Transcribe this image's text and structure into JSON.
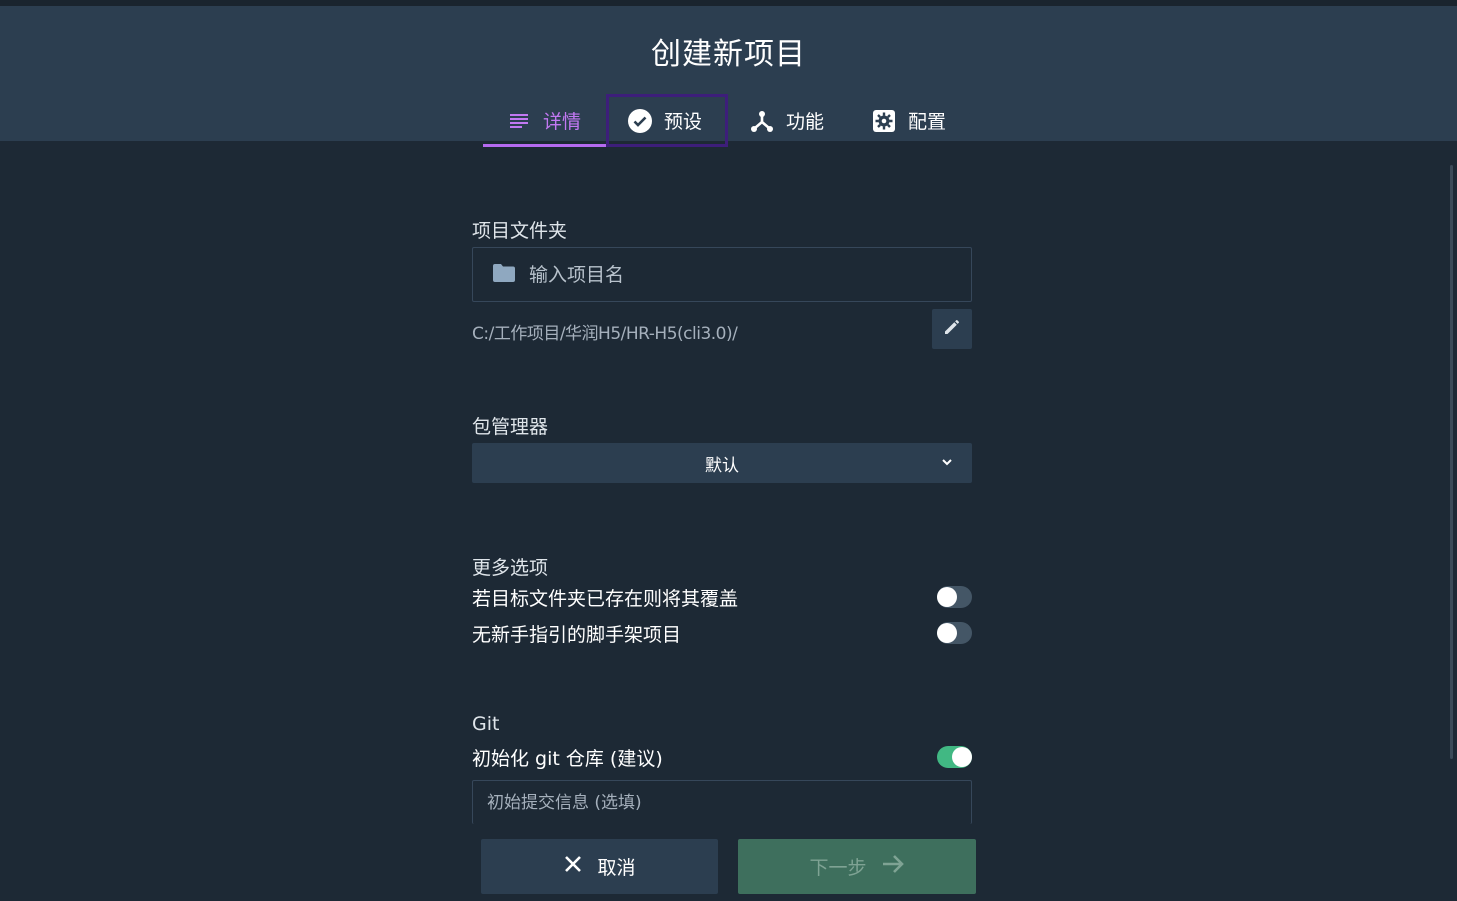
{
  "header": {
    "title": "创建新项目",
    "tabs": [
      {
        "label": "详情",
        "icon": "list-icon",
        "active": true
      },
      {
        "label": "预设",
        "icon": "check-circle-icon",
        "active": false
      },
      {
        "label": "功能",
        "icon": "branch-icon",
        "active": false
      },
      {
        "label": "配置",
        "icon": "gear-icon",
        "active": false
      }
    ]
  },
  "folder": {
    "label": "项目文件夹",
    "placeholder": "输入项目名",
    "value": "",
    "path": "C:/工作项目/华润H5/HR-H5(cli3.0)/"
  },
  "package_manager": {
    "label": "包管理器",
    "selected": "默认"
  },
  "more_options": {
    "label": "更多选项",
    "force": {
      "label": "若目标文件夹已存在则将其覆盖",
      "on": false
    },
    "bare": {
      "label": "无新手指引的脚手架项目",
      "on": false
    }
  },
  "git": {
    "label": "Git",
    "init": {
      "label": "初始化 git 仓库 (建议)",
      "on": true
    },
    "commit_placeholder": "初始提交信息 (选填)"
  },
  "footer": {
    "cancel_label": "取消",
    "next_label": "下一步"
  },
  "colors": {
    "accent": "#b56af0",
    "toggle_on": "#41b883",
    "header_bg": "#2c3e50",
    "page_bg": "#1d2935"
  }
}
